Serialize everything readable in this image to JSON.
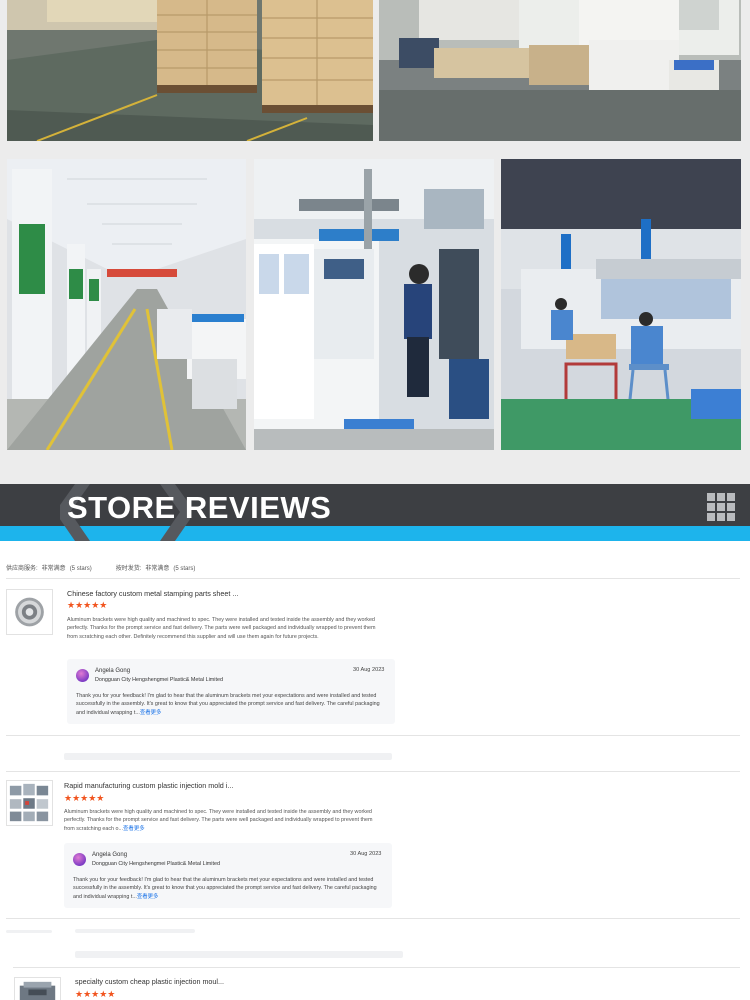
{
  "section_title": "STORE REVIEWS",
  "summary": {
    "supplier_label": "供应商服务:",
    "supplier_value": "非常满意",
    "supplier_stars": "(5 stars)",
    "ontime_label": "按时发货:",
    "ontime_value": "非常满意",
    "ontime_stars": "(5 stars)"
  },
  "reviews": [
    {
      "title": "Chinese factory custom metal stamping parts sheet ...",
      "stars": "★★★★★",
      "body": "Aluminum brackets were high quality and machined to spec.  They were installed and tested inside the assembly and they worked perfectly.  Thanks for the prompt service and fast delivery.  The parts were well packaged and individually wrapped to prevent them from scratching each other.  Definitely recommend this supplier and will use them again for future projects.",
      "body_more": "",
      "reply": {
        "name": "Angela Gong",
        "company": "Dongguan City Hengshengmei Plastic& Metal Limited",
        "date": "30 Aug 2023",
        "body": "Thank you for your feedback! I'm glad to hear that the aluminum brackets met your expectations and were installed and tested successfully in the assembly. It's great to know that you appreciated the prompt service and fast delivery. The careful packaging and individual wrapping t...",
        "more": "查看更多"
      }
    },
    {
      "title": "Rapid manufacturing custom plastic injection mold i...",
      "stars": "★★★★★",
      "body": "Aluminum brackets were high quality and machined to spec.  They were installed and tested inside the assembly and they worked perfectly.  Thanks for the prompt service and fast delivery.  The parts were well packaged and individually wrapped to prevent them from scratching each o...",
      "body_more": "查看更多",
      "reply": {
        "name": "Angela Gong",
        "company": "Dongguan City Hengshengmei Plastic& Metal Limited",
        "date": "30 Aug 2023",
        "body": "Thank you for your feedback! I'm glad to hear that the aluminum brackets met your expectations and were installed and tested successfully in the assembly. It's great to know that you appreciated the prompt service and fast delivery. The careful packaging and individual wrapping t...",
        "more": "查看更多"
      }
    },
    {
      "title": "specialty custom cheap plastic injection moul...",
      "stars": "★★★★★"
    }
  ],
  "colors": {
    "banner_dark": "#3d3f43",
    "banner_accent": "#1db4ec",
    "star": "#f1541e",
    "link": "#1a73e8"
  },
  "icons": [
    "grid-icon",
    "avatar"
  ]
}
